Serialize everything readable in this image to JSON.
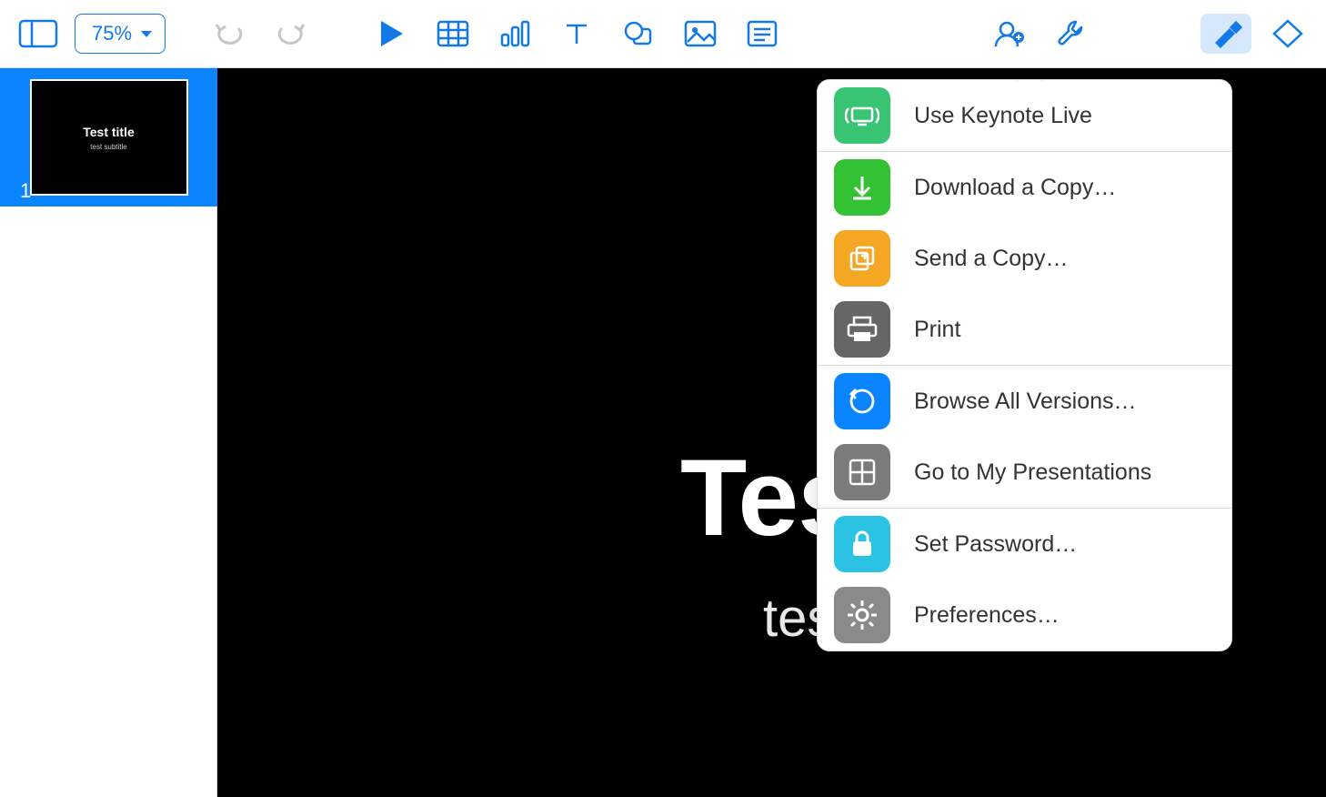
{
  "toolbar": {
    "zoom_label": "75%"
  },
  "sidebar": {
    "slides": [
      {
        "index": "1",
        "title": "Test title",
        "subtitle": "test subtitle"
      }
    ]
  },
  "slide": {
    "title": "Test title",
    "subtitle": "test subtitle"
  },
  "tools_menu": {
    "items": [
      {
        "id": "keynote-live",
        "label": "Use Keynote Live"
      },
      {
        "id": "download",
        "label": "Download a Copy…"
      },
      {
        "id": "send",
        "label": "Send a Copy…"
      },
      {
        "id": "print",
        "label": "Print"
      },
      {
        "id": "versions",
        "label": "Browse All Versions…"
      },
      {
        "id": "go-presentations",
        "label": "Go to My Presentations"
      },
      {
        "id": "password",
        "label": "Set Password…"
      },
      {
        "id": "preferences",
        "label": "Preferences…"
      }
    ]
  }
}
